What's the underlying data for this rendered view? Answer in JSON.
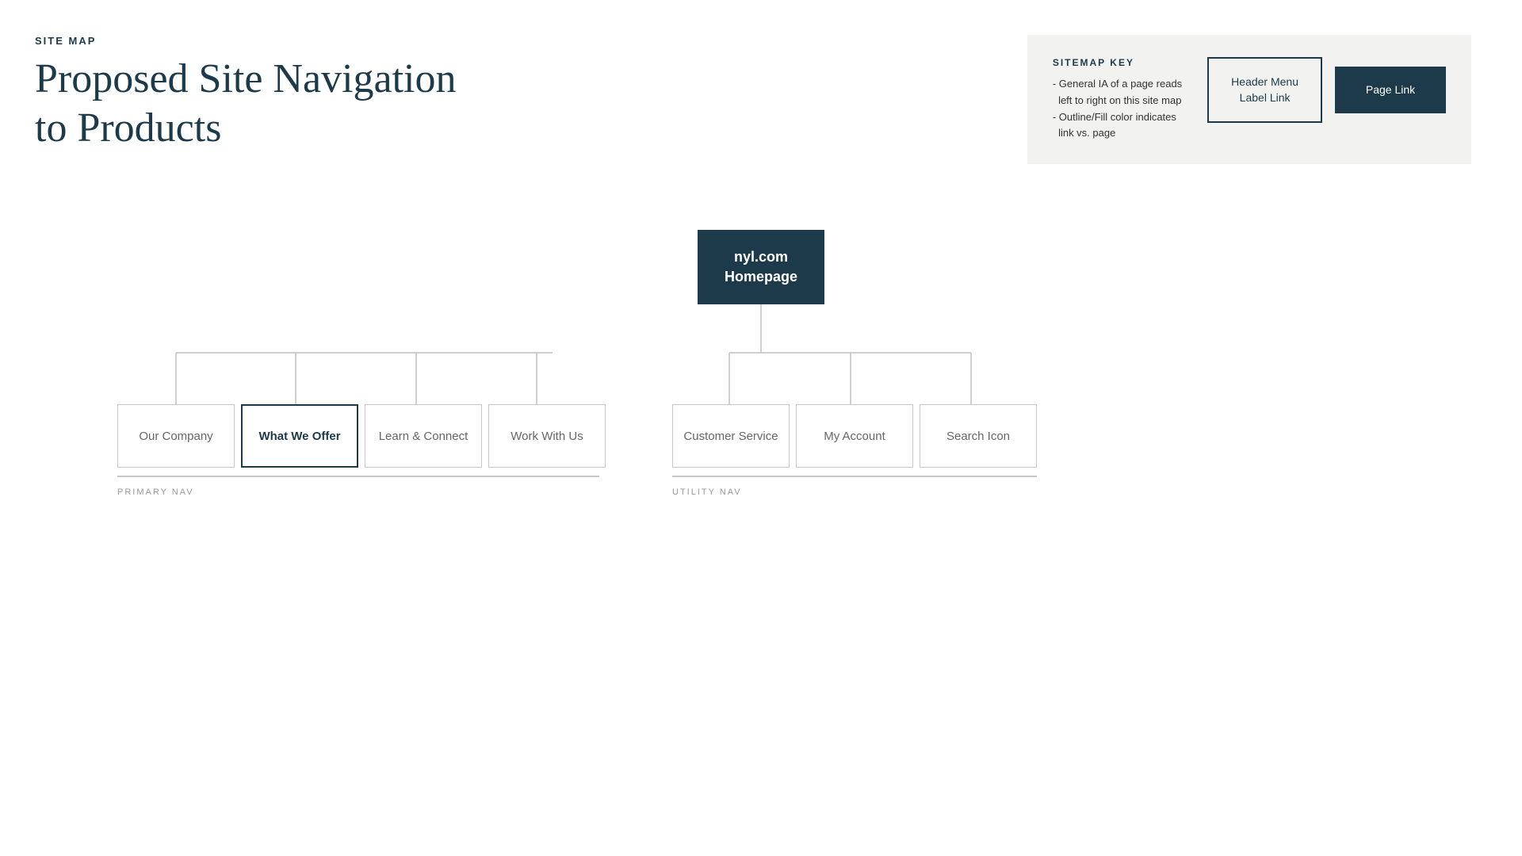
{
  "header": {
    "site_map_label": "SITE MAP",
    "page_title_line1": "Proposed Site Navigation",
    "page_title_line2": "to Products"
  },
  "sitemap_key": {
    "label": "SITEMAP KEY",
    "bullet1": "- General IA of a page reads",
    "bullet1b": "  left to right on this site map",
    "bullet2": "- Outline/Fill color indicates",
    "bullet2b": "  link vs. page",
    "key1_label": "Header Menu\nLabel Link",
    "key2_label": "Page Link"
  },
  "root_node": {
    "line1": "nyl.com",
    "line2": "Homepage"
  },
  "primary_nav": {
    "label": "PRIMARY NAV",
    "items": [
      {
        "text": "Our Company",
        "selected": false
      },
      {
        "text": "What We Offer",
        "selected": true
      },
      {
        "text": "Learn & Connect",
        "selected": false
      },
      {
        "text": "Work With Us",
        "selected": false
      }
    ]
  },
  "utility_nav": {
    "label": "UTILITY NAV",
    "items": [
      {
        "text": "Customer Service",
        "selected": false
      },
      {
        "text": "My Account",
        "selected": false
      },
      {
        "text": "Search Icon",
        "selected": false
      }
    ]
  },
  "colors": {
    "dark_navy": "#1c3a4a",
    "light_border": "#c8c8c8",
    "background_key": "#f2f2f0"
  }
}
